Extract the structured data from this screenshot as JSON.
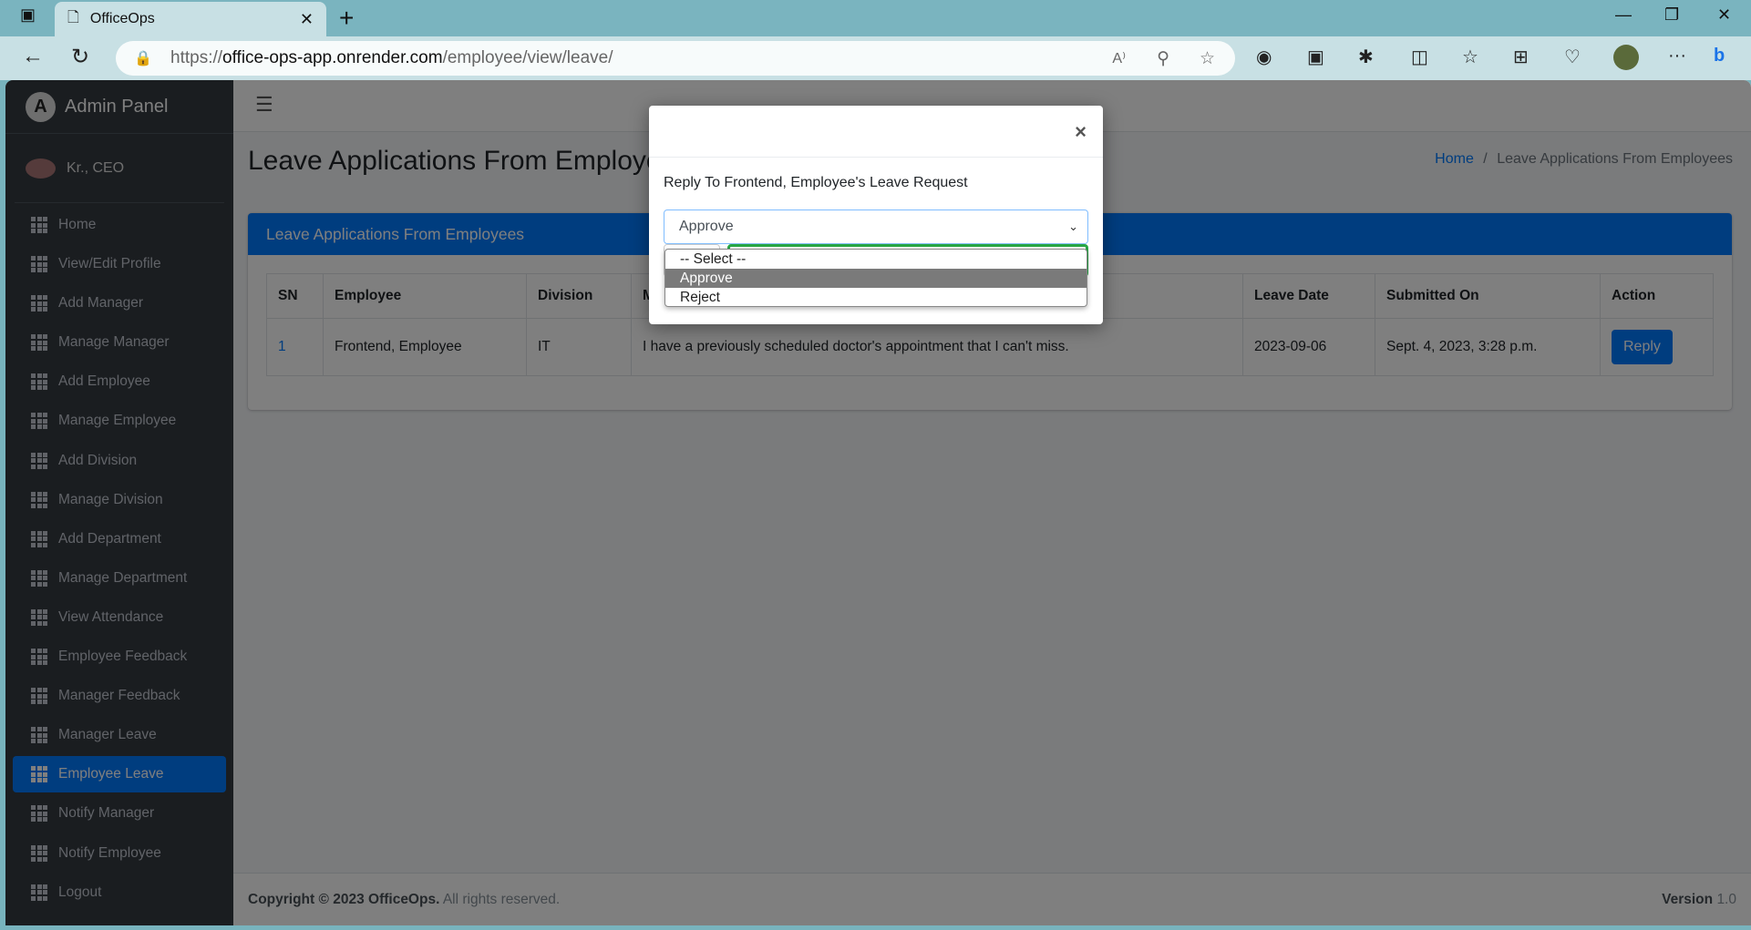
{
  "browser": {
    "tab_title": "OfficeOps",
    "url_scheme": "https://",
    "url_host": "office-ops-app.onrender.com",
    "url_path": "/employee/view/leave/"
  },
  "sidebar": {
    "brand": "Admin Panel",
    "user": "Kr., CEO",
    "items": [
      {
        "label": "Home"
      },
      {
        "label": "View/Edit Profile"
      },
      {
        "label": "Add Manager"
      },
      {
        "label": "Manage Manager"
      },
      {
        "label": "Add Employee"
      },
      {
        "label": "Manage Employee"
      },
      {
        "label": "Add Division"
      },
      {
        "label": "Manage Division"
      },
      {
        "label": "Add Department"
      },
      {
        "label": "Manage Department"
      },
      {
        "label": "View Attendance"
      },
      {
        "label": "Employee Feedback"
      },
      {
        "label": "Manager Feedback"
      },
      {
        "label": "Manager Leave"
      },
      {
        "label": "Employee Leave",
        "active": true
      },
      {
        "label": "Notify Manager"
      },
      {
        "label": "Notify Employee"
      },
      {
        "label": "Logout"
      }
    ]
  },
  "page": {
    "title": "Leave Applications From Employees",
    "breadcrumb_home": "Home",
    "breadcrumb_sep": "/",
    "breadcrumb_current": "Leave Applications From Employees"
  },
  "card": {
    "title": "Leave Applications From Employees",
    "headers": [
      "SN",
      "Employee",
      "Division",
      "Message",
      "Leave Date",
      "Submitted On",
      "Action"
    ],
    "rows": [
      {
        "sn": "1",
        "employee": "Frontend, Employee",
        "division": "IT",
        "message": "I have a previously scheduled doctor's appointment that I can't miss.",
        "leave_date": "2023-09-06",
        "submitted_on": "Sept. 4, 2023, 3:28 p.m.",
        "action": "Reply"
      }
    ]
  },
  "footer": {
    "copyright": "Copyright © 2023 OfficeOps.",
    "rights": " All rights reserved.",
    "version_label": "Version",
    "version": "1.0"
  },
  "modal": {
    "close": "×",
    "text": "Reply To Frontend, Employee's Leave Request",
    "selected": "Approve",
    "options": [
      "-- Select --",
      "Approve",
      "Reject"
    ],
    "highlighted": "Approve"
  },
  "colors": {
    "primary": "#007bff",
    "sidebar": "#343a40",
    "success": "#28a745"
  }
}
